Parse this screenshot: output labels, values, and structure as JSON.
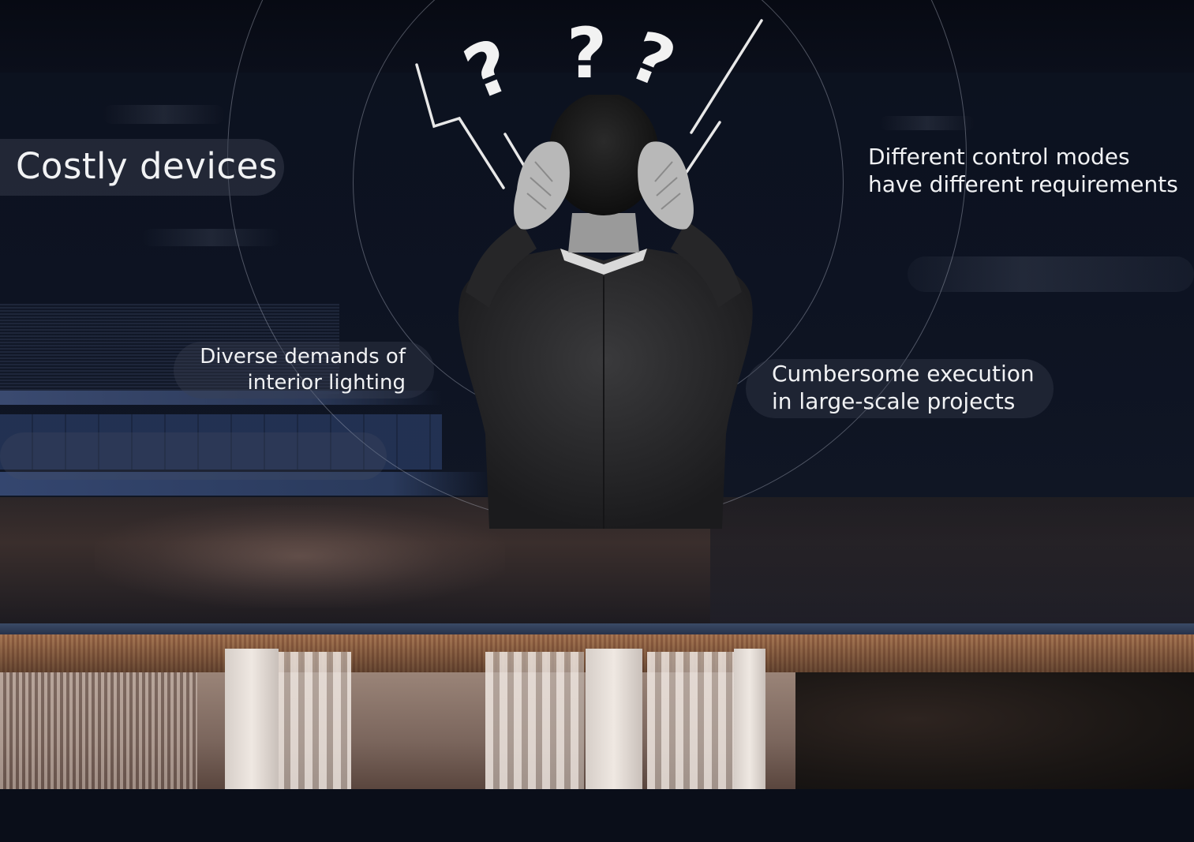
{
  "labels": {
    "costly_devices": "Costly devices",
    "diverse_demands": {
      "line1": "Diverse demands of",
      "line2": "interior lighting"
    },
    "different_control": {
      "line1": "Different control modes",
      "line2": "have different requirements"
    },
    "cumbersome": {
      "line1": "Cumbersome execution",
      "line2": "in large-scale projects"
    }
  },
  "icons": {
    "question_marks": "question-mark-icon",
    "lightning": "lightning-icon"
  },
  "colors": {
    "background": "#0c111e",
    "text": "#f1f2f4",
    "ring": "#bec3d2",
    "soffit_wood": "#c48a5e"
  }
}
